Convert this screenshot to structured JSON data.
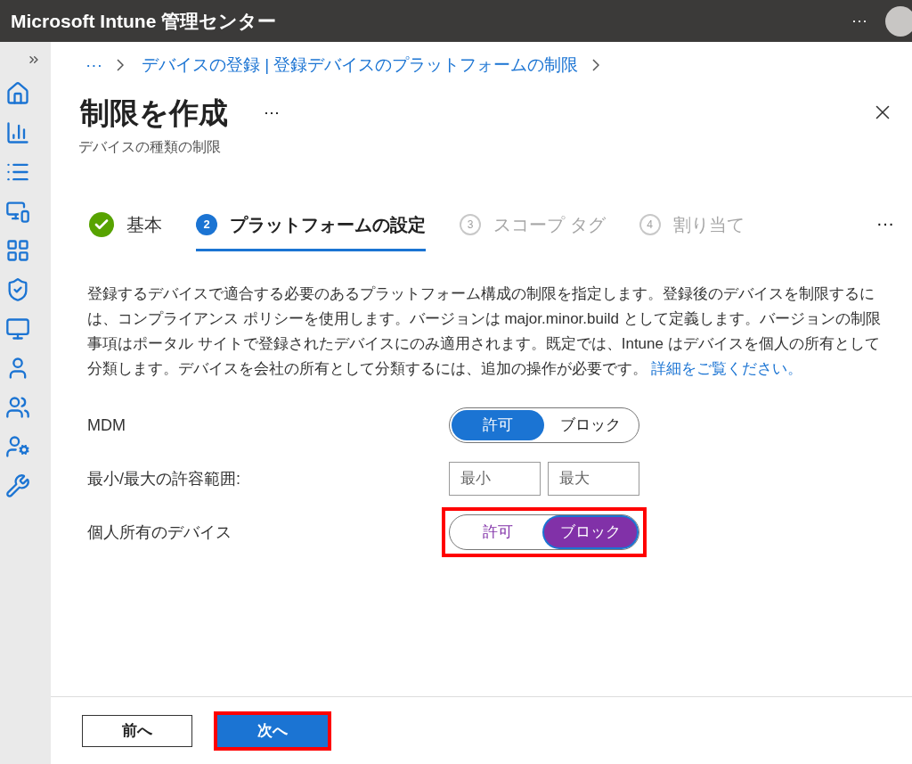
{
  "header": {
    "title": "Microsoft Intune 管理センター",
    "more": "···"
  },
  "breadcrumb": [
    {
      "text": "···"
    },
    {
      "text": "デバイスの登録 | 登録デバイスのプラットフォームの制限"
    }
  ],
  "page": {
    "title": "制限を作成",
    "more": "···",
    "subtitle": "デバイスの種類の制限"
  },
  "steps": [
    {
      "label": "基本",
      "completed": true,
      "selected": false
    },
    {
      "number": "2",
      "label": "プラットフォームの設定",
      "completed": false,
      "selected": true
    },
    {
      "number": "3",
      "label": "スコープ タグ",
      "completed": false,
      "selected": false
    },
    {
      "number": "4",
      "label": "割り当て",
      "completed": false,
      "selected": false
    }
  ],
  "steps_more": "···",
  "description": {
    "text": "登録するデバイスで適合する必要のあるプラットフォーム構成の制限を指定します。登録後のデバイスを制限するには、コンプライアンス ポリシーを使用します。バージョンは major.minor.build として定義します。バージョンの制限事項はポータル サイトで登録されたデバイスにのみ適用されます。既定では、Intune はデバイスを個人の所有として分類します。デバイスを会社の所有として分類するには、追加の操作が必要です。",
    "link": "詳細をご覧ください。"
  },
  "settings": [
    {
      "kind": "toggle",
      "label": "MDM",
      "color": "#1b74d3",
      "highlighted": false,
      "options": [
        {
          "label": "許可",
          "selected": true
        },
        {
          "label": "ブロック",
          "selected": false
        }
      ]
    },
    {
      "kind": "range",
      "label": "最小/最大の許容範囲:",
      "fields": [
        {
          "placeholder": "最小"
        },
        {
          "placeholder": "最大"
        }
      ]
    },
    {
      "kind": "toggle",
      "label": "個人所有のデバイス",
      "color": "#8131a8",
      "highlighted": true,
      "options": [
        {
          "label": "許可",
          "selected": false
        },
        {
          "label": "ブロック",
          "selected": true
        }
      ]
    }
  ],
  "footer": [
    {
      "kind": "secondary",
      "label": "前へ",
      "highlighted": false
    },
    {
      "kind": "primary",
      "label": "次へ",
      "highlighted": true
    }
  ]
}
